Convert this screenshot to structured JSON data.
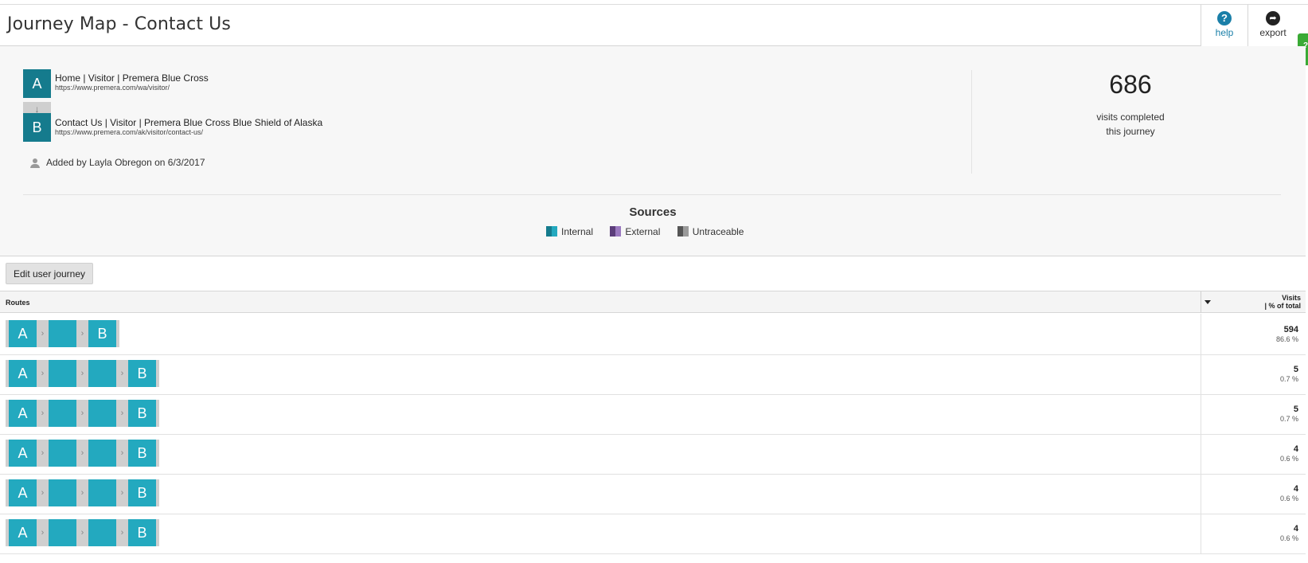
{
  "header": {
    "title": "Journey Map - Contact Us",
    "help_label": "help",
    "export_label": "export",
    "side_tab_label": "?"
  },
  "journey": {
    "steps": [
      {
        "letter": "A",
        "title": "Home | Visitor | Premera Blue Cross",
        "url": "https://www.premera.com/wa/visitor/"
      },
      {
        "letter": "B",
        "title": "Contact Us | Visitor | Premera Blue Cross Blue Shield of Alaska",
        "url": "https://www.premera.com/ak/visitor/contact-us/"
      }
    ],
    "arrow": "↓",
    "added_by": "Added by Layla Obregon on 6/3/2017"
  },
  "stats": {
    "visits": "686",
    "caption_line1": "visits completed",
    "caption_line2": "this journey"
  },
  "sources": {
    "title": "Sources",
    "items": [
      {
        "label": "Internal",
        "color1": "#157b8d",
        "color2": "#23a9bf"
      },
      {
        "label": "External",
        "color1": "#5b3d7a",
        "color2": "#9a78bf"
      },
      {
        "label": "Untraceable",
        "color1": "#555555",
        "color2": "#9a9a9a"
      }
    ]
  },
  "edit_button_label": "Edit user journey",
  "table": {
    "routes_header": "Routes",
    "visits_header_line1": "Visits",
    "visits_header_line2": "| % of total",
    "rows": [
      {
        "nodes": [
          "A",
          "",
          "B"
        ],
        "count": "594",
        "pct": "86.6 %"
      },
      {
        "nodes": [
          "A",
          "",
          "",
          "B"
        ],
        "count": "5",
        "pct": "0.7 %"
      },
      {
        "nodes": [
          "A",
          "",
          "",
          "B"
        ],
        "count": "5",
        "pct": "0.7 %"
      },
      {
        "nodes": [
          "A",
          "",
          "",
          "B"
        ],
        "count": "4",
        "pct": "0.6 %"
      },
      {
        "nodes": [
          "A",
          "",
          "",
          "B"
        ],
        "count": "4",
        "pct": "0.6 %"
      },
      {
        "nodes": [
          "A",
          "",
          "",
          "B"
        ],
        "count": "4",
        "pct": "0.6 %"
      }
    ]
  },
  "colors": {
    "step_dark": "#157b8d",
    "route_node": "#23a9bf",
    "accent_green": "#3aaa35"
  }
}
